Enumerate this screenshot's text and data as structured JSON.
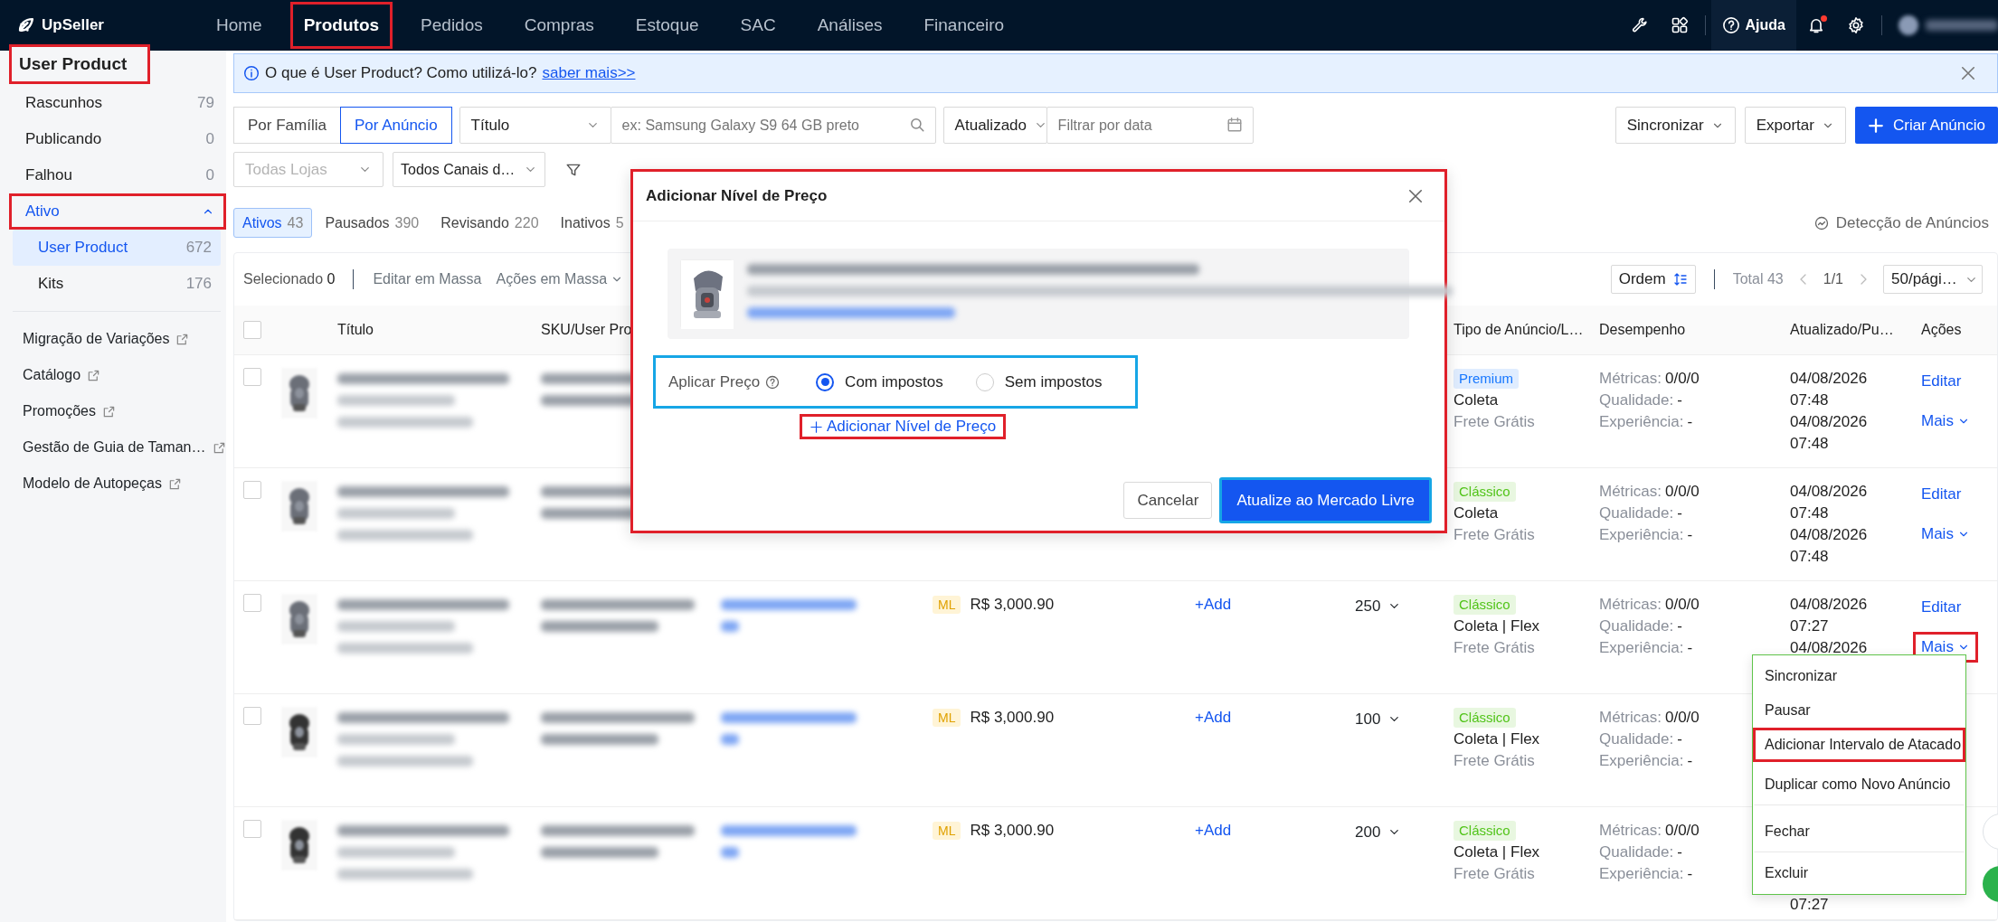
{
  "topbar": {
    "logo": "UpSeller",
    "nav": [
      {
        "label": "Home",
        "selected": false
      },
      {
        "label": "Produtos",
        "selected": true,
        "annotation": {
          "color": "#e0202a"
        }
      },
      {
        "label": "Pedidos",
        "selected": false
      },
      {
        "label": "Compras",
        "selected": false
      },
      {
        "label": "Estoque",
        "selected": false
      },
      {
        "label": "SAC",
        "selected": false
      },
      {
        "label": "Análises",
        "selected": false
      },
      {
        "label": "Financeiro",
        "selected": false
      }
    ],
    "help": "Ajuda",
    "notification": true
  },
  "sidebar": {
    "title": "User Product",
    "title_annotation": {
      "color": "#e0202a"
    },
    "items": [
      {
        "label": "Rascunhos",
        "count": "79",
        "selected": false
      },
      {
        "label": "Publicando",
        "count": "0",
        "selected": false
      },
      {
        "label": "Falhou",
        "count": "0",
        "selected": false
      },
      {
        "label": "Ativo",
        "selected": true,
        "expanded": true,
        "annotation": {
          "color": "#e0202a"
        },
        "children": [
          {
            "label": "User Product",
            "count": "672",
            "selected": true
          },
          {
            "label": "Kits",
            "count": "176",
            "selected": false
          }
        ]
      }
    ],
    "links": [
      "Migração de Variações",
      "Catálogo",
      "Promoções",
      "Gestão de Guia de Taman…",
      "Modelo de Autopeças"
    ]
  },
  "banner": {
    "text": "O que é User Product? Como utilizá-lo?",
    "link": "saber mais>>"
  },
  "filters": {
    "modes": [
      {
        "label": "Por Família",
        "selected": false
      },
      {
        "label": "Por Anúncio",
        "selected": true
      }
    ],
    "search_by": "Título",
    "search": {
      "placeholder": "ex: Samsung Galaxy S9 64 GB preto"
    },
    "date_by": "Atualizado",
    "date": {
      "placeholder": "Filtrar por data"
    },
    "store": {
      "placeholder": "Todas Lojas"
    },
    "channel": "Todos Canais d…",
    "actions": [
      {
        "label": "Sincronizar",
        "kind": "dropdown"
      },
      {
        "label": "Exportar",
        "kind": "dropdown"
      },
      {
        "label": "Criar Anúncio",
        "kind": "primary"
      }
    ]
  },
  "status_tabs": [
    {
      "label": "Ativos",
      "count": "43",
      "selected": true
    },
    {
      "label": "Pausados",
      "count": "390",
      "selected": false
    },
    {
      "label": "Revisando",
      "count": "220",
      "selected": false
    },
    {
      "label": "Inativos",
      "count": "5",
      "selected": false
    }
  ],
  "detection": "Detecção de Anúncios",
  "toolbar": {
    "selected_label": "Selecionado",
    "selected_count": "0",
    "bulk_edit": "Editar em Massa",
    "bulk_actions": "Ações em Massa",
    "sort": "Ordem",
    "total": "Total 43",
    "page": "1/1",
    "page_size": "50/pági…"
  },
  "table": {
    "select_all_checked": false,
    "header": {
      "title": "Título",
      "sku": "SKU/User Pro",
      "type": "Tipo de Anúncio/L…",
      "performance": "Desempenho",
      "updated": "Atualizado/Pu…",
      "actions": "Ações"
    },
    "rows": [
      {
        "checked": false,
        "badge": {
          "text": "Premium",
          "color": "#1677ff"
        },
        "logistics": "Coleta",
        "shipping": "Frete Grátis",
        "metrics": [
          {
            "name": "Métricas:",
            "reading": "0/0/0"
          },
          {
            "name": "Qualidade:",
            "reading": "-"
          },
          {
            "name": "Experiência:",
            "reading": "-"
          }
        ],
        "updated": [
          "04/08/2026",
          "07:48",
          "04/08/2026",
          "07:48"
        ],
        "actions": [
          "Editar",
          "Mais"
        ]
      },
      {
        "checked": false,
        "badge": {
          "text": "Clássico",
          "color": "#52c41a"
        },
        "logistics": "Coleta",
        "shipping": "Frete Grátis",
        "metrics": [
          {
            "name": "Métricas:",
            "reading": "0/0/0"
          },
          {
            "name": "Qualidade:",
            "reading": "-"
          },
          {
            "name": "Experiência:",
            "reading": "-"
          }
        ],
        "updated": [
          "04/08/2026",
          "07:48",
          "04/08/2026",
          "07:48"
        ],
        "actions": [
          "Editar",
          "Mais"
        ]
      },
      {
        "checked": false,
        "channel": "ML",
        "price": "R$ 3,000.90",
        "wholesale": "+Add",
        "stock": "250",
        "badge": {
          "text": "Clássico",
          "color": "#52c41a"
        },
        "logistics": "Coleta | Flex",
        "shipping": "Frete Grátis",
        "metrics": [
          {
            "name": "Métricas:",
            "reading": "0/0/0"
          },
          {
            "name": "Qualidade:",
            "reading": "-"
          },
          {
            "name": "Experiência:",
            "reading": "-"
          }
        ],
        "updated": [
          "04/08/2026",
          "07:27",
          "04/08/2026"
        ],
        "actions": [
          "Editar",
          "Mais"
        ],
        "more_annotation": {
          "color": "#e0202a"
        }
      },
      {
        "checked": false,
        "channel": "ML",
        "price": "R$ 3,000.90",
        "wholesale": "+Add",
        "stock": "100",
        "badge": {
          "text": "Clássico",
          "color": "#52c41a"
        },
        "logistics": "Coleta | Flex",
        "shipping": "Frete Grátis",
        "metrics": [
          {
            "name": "Métricas:",
            "reading": "0/0/0"
          },
          {
            "name": "Qualidade:",
            "reading": "-"
          },
          {
            "name": "Experiência:",
            "reading": "-"
          }
        ]
      },
      {
        "checked": false,
        "channel": "ML",
        "price": "R$ 3,000.90",
        "wholesale": "+Add",
        "stock": "200",
        "badge": {
          "text": "Clássico",
          "color": "#52c41a"
        },
        "logistics": "Coleta | Flex",
        "shipping": "Frete Grátis",
        "metrics": [
          {
            "name": "Métricas:",
            "reading": "0/0/0"
          },
          {
            "name": "Qualidade:",
            "reading": "-"
          },
          {
            "name": "Experiência:",
            "reading": "-"
          }
        ],
        "updated": [
          "07:27"
        ],
        "updated_cut_top": true
      }
    ]
  },
  "menu": {
    "items": [
      {
        "label": "Sincronizar",
        "divider_after": false
      },
      {
        "label": "Pausar",
        "divider_after": false
      },
      {
        "label": "Adicionar Intervalo de Atacado",
        "divider_after": false,
        "annotation": {
          "color": "#e0202a"
        }
      },
      {
        "label": "Duplicar como Novo Anúncio",
        "divider_after": true
      },
      {
        "label": "Fechar",
        "divider_after": true
      },
      {
        "label": "Excluir",
        "divider_after": false
      }
    ]
  },
  "modal": {
    "title": "Adicionar Nível de Preço",
    "annotation": {
      "color": "#e0202a"
    },
    "apply_label": "Aplicar Preço",
    "options": [
      {
        "label": "Com impostos",
        "selected": true
      },
      {
        "label": "Sem impostos",
        "selected": false
      }
    ],
    "options_annotation": {
      "color": "#16a6e6"
    },
    "add_link": "Adicionar Nível de Preço",
    "add_annotation": {
      "color": "#e0202a"
    },
    "buttons": [
      {
        "label": "Cancelar",
        "kind": "secondary"
      },
      {
        "label": "Atualize ao Mercado Livre",
        "kind": "primary",
        "annotation": {
          "color": "#16a6e6"
        }
      }
    ]
  }
}
